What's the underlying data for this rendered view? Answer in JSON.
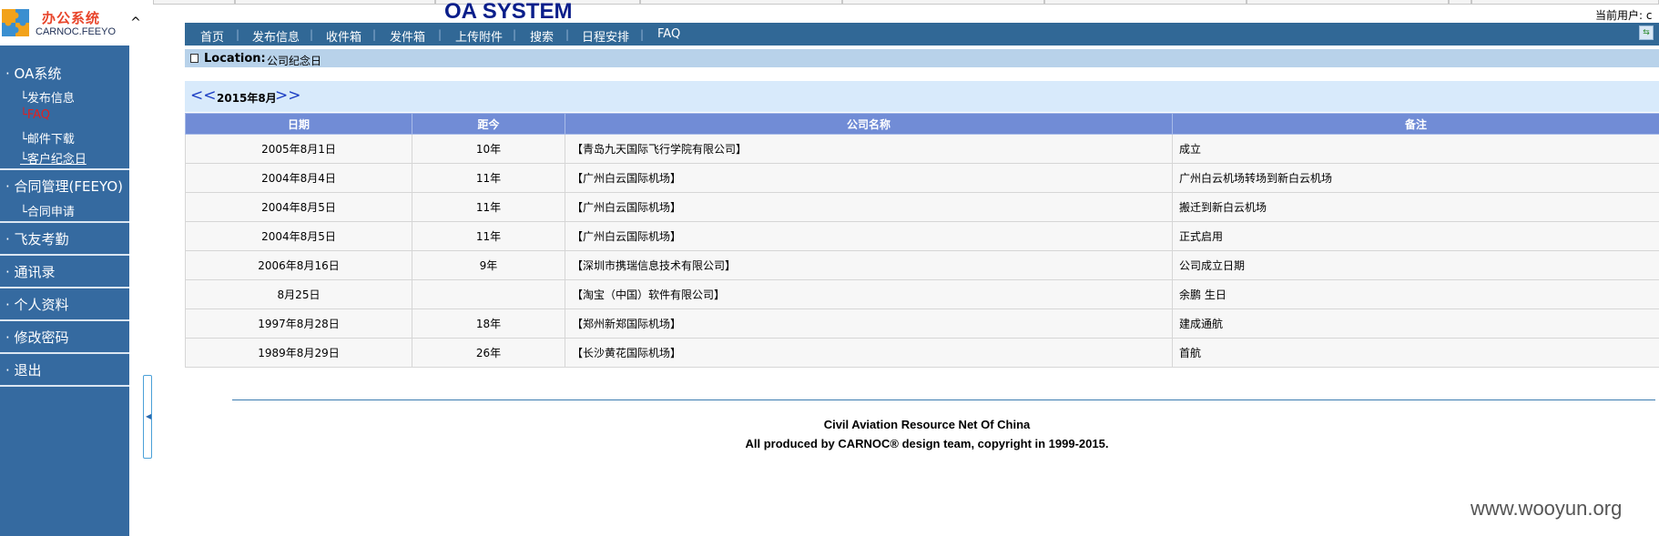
{
  "sidebar": {
    "logo_title": "办公系统",
    "logo_subtitle": "CARNOC.FEEYO",
    "collapse_glyph": "^",
    "groups": [
      {
        "label": "· OA系统",
        "items": [
          {
            "label": "└发布信息",
            "state": "normal"
          },
          {
            "label": "└FAQ",
            "state": "active"
          },
          {
            "label": "└邮件下载",
            "state": "normal"
          },
          {
            "label": "└客户纪念日",
            "state": "link"
          }
        ]
      },
      {
        "label": "· 合同管理(FEEYO)",
        "items": [
          {
            "label": "└合同申请",
            "state": "normal"
          }
        ]
      },
      {
        "label": "· 飞友考勤",
        "items": []
      },
      {
        "label": "· 通讯录",
        "items": []
      },
      {
        "label": "· 个人资料",
        "items": []
      },
      {
        "label": "· 修改密码",
        "items": []
      },
      {
        "label": "· 退出",
        "items": []
      }
    ]
  },
  "header": {
    "system_title": "OA SYSTEM",
    "current_user": "当前用户: c"
  },
  "nav": {
    "items": [
      "首页",
      "发布信息",
      "收件箱",
      "发件箱",
      "上传附件",
      "搜索",
      "日程安排",
      "FAQ"
    ],
    "separator": "|"
  },
  "location": {
    "label": "Location:",
    "value": "公司纪念日"
  },
  "calendar": {
    "prev": "<<",
    "month": "2015年8月",
    "next": ">>"
  },
  "table": {
    "headers": [
      "日期",
      "距今",
      "公司名称",
      "备注"
    ],
    "rows": [
      [
        "2005年8月1日",
        "10年",
        "【青岛九天国际飞行学院有限公司】",
        "成立"
      ],
      [
        "2004年8月4日",
        "11年",
        "【广州白云国际机场】",
        "广州白云机场转场到新白云机场"
      ],
      [
        "2004年8月5日",
        "11年",
        "【广州白云国际机场】",
        "搬迁到新白云机场"
      ],
      [
        "2004年8月5日",
        "11年",
        "【广州白云国际机场】",
        "正式启用"
      ],
      [
        "2006年8月16日",
        "9年",
        "【深圳市携瑞信息技术有限公司】",
        "公司成立日期"
      ],
      [
        "8月25日",
        "",
        "【淘宝（中国）软件有限公司】",
        "余鹏 生日"
      ],
      [
        "1997年8月28日",
        "18年",
        "【郑州新郑国际机场】",
        "建成通航"
      ],
      [
        "1989年8月29日",
        "26年",
        "【长沙黄花国际机场】",
        "首航"
      ]
    ]
  },
  "footer": {
    "line1": "Civil Aviation Resource Net Of China",
    "line2": "All produced by CARNOC® design team, copyright in 1999-2015."
  },
  "watermark": "www.wooyun.org",
  "colors": {
    "sidebar_bg": "#356aa0",
    "navbar_bg": "#316896",
    "table_header_bg": "#718cd6",
    "active_item": "#e02020",
    "title": "#0a1e8a"
  }
}
